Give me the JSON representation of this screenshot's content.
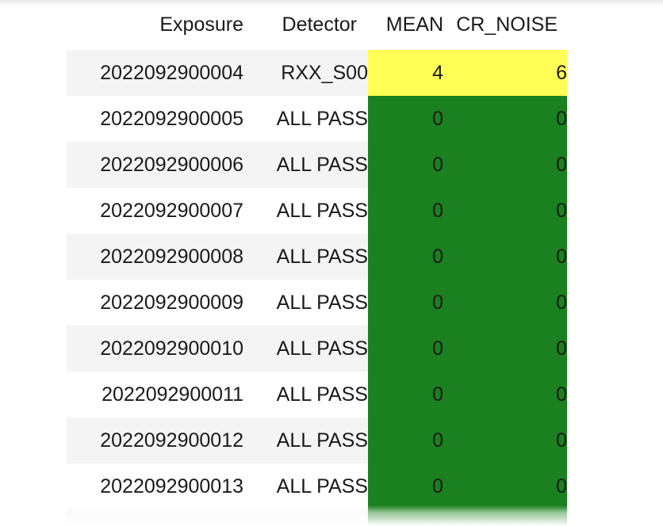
{
  "table": {
    "columns": [
      {
        "key": "exposure",
        "label": "Exposure",
        "align": "right"
      },
      {
        "key": "detector",
        "label": "Detector",
        "align": "right"
      },
      {
        "key": "mean",
        "label": "MEAN",
        "align": "right"
      },
      {
        "key": "cr_noise",
        "label": "CR_NOISE",
        "align": "right"
      }
    ],
    "rows": [
      {
        "exposure": "2022092900004",
        "detector": "RXX_S00",
        "mean": "4",
        "cr_noise": "6",
        "status": "warn"
      },
      {
        "exposure": "2022092900005",
        "detector": "ALL PASS",
        "mean": "0",
        "cr_noise": "0",
        "status": "pass"
      },
      {
        "exposure": "2022092900006",
        "detector": "ALL PASS",
        "mean": "0",
        "cr_noise": "0",
        "status": "pass"
      },
      {
        "exposure": "2022092900007",
        "detector": "ALL PASS",
        "mean": "0",
        "cr_noise": "0",
        "status": "pass"
      },
      {
        "exposure": "2022092900008",
        "detector": "ALL PASS",
        "mean": "0",
        "cr_noise": "0",
        "status": "pass"
      },
      {
        "exposure": "2022092900009",
        "detector": "ALL PASS",
        "mean": "0",
        "cr_noise": "0",
        "status": "pass"
      },
      {
        "exposure": "2022092900010",
        "detector": "ALL PASS",
        "mean": "0",
        "cr_noise": "0",
        "status": "pass"
      },
      {
        "exposure": "2022092900011",
        "detector": "ALL PASS",
        "mean": "0",
        "cr_noise": "0",
        "status": "pass"
      },
      {
        "exposure": "2022092900012",
        "detector": "ALL PASS",
        "mean": "0",
        "cr_noise": "0",
        "status": "pass"
      },
      {
        "exposure": "2022092900013",
        "detector": "ALL PASS",
        "mean": "0",
        "cr_noise": "0",
        "status": "pass"
      }
    ]
  },
  "colors": {
    "status_pass": "#1b8020",
    "status_warn": "#ffff55",
    "stripe": "#f4f4f4",
    "background": "#ffffff",
    "text": "#1a1a1a"
  }
}
